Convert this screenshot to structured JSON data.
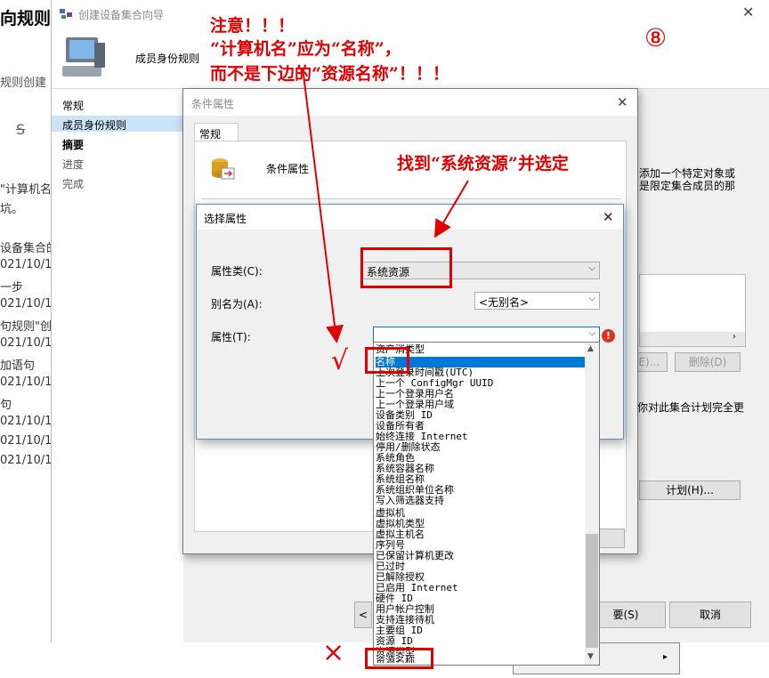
{
  "background": {
    "title": "向规则",
    "subtitle": "规则创建",
    "strike_icon": "S",
    "lines": [
      "\"计算机名",
      "坑。",
      "设备集合的",
      "021/10/1",
      "一步",
      "021/10/1",
      "句规则\"创",
      "021/10/1",
      "加语句",
      "021/10/1",
      "句",
      "021/10/1",
      "021/10/1",
      "021/10/1"
    ]
  },
  "wizard": {
    "title": "创建设备集合向导",
    "header_label": "成员身份规则",
    "nav": [
      "常规",
      "成员身份规则",
      "摘要",
      "进度",
      "完成"
    ],
    "right_text_1": "添加一个特定对象或",
    "right_text_2": "是限定集合成员的那",
    "delete_button": "删除(D)",
    "edit_button": "(E)...",
    "notify_text": "你对此集合计划完全更",
    "schedule_button": "计划(H)...",
    "next_button": "<",
    "summary_button": "要(S)",
    "cancel_button": "取消"
  },
  "condition_dialog": {
    "title": "条件属性",
    "tab": "常规",
    "label": "条件属性"
  },
  "select_dialog": {
    "title": "选择属性",
    "class_label": "属性类(C):",
    "class_value": "系统资源",
    "alias_label": "别名为(A):",
    "alias_value": "<无别名>",
    "attr_label": "属性(T):",
    "attr_value": ""
  },
  "dropdown_items": [
    "资产消类型",
    "名称",
    "上次登录时间戳(UTC)",
    "上一个 ConfigMgr UUID",
    "上一个登录用户名",
    "上一个登录用户域",
    "设备类别 ID",
    "设备所有者",
    "始终连接 Internet",
    "停用/删除状态",
    "系统角色",
    "系统容器名称",
    "系统组名称",
    "系统组织单位名称",
    "写入筛选器支持",
    "虚拟机",
    "虚拟机类型",
    "虚拟主机名",
    "序列号",
    "已保留计算机更改",
    "已过时",
    "已解除授权",
    "已启用 Internet",
    "硬件 ID",
    "用户帐户控制",
    "支持连接待机",
    "主要组 ID",
    "资源 ID",
    "资源类型",
    "资源名称"
  ],
  "annotations": {
    "notice_1": "注意！！！",
    "notice_2": "“计算机名”应为“名称”，",
    "notice_3": "而不是下边的“资源名称”！！！",
    "step_number": "⑧",
    "find_text": "找到“系统资源”并选定",
    "check_mark": "√",
    "cross_mark": "×"
  },
  "colors": {
    "annotation_red": "#e00000",
    "selection_blue": "#0078d7"
  }
}
